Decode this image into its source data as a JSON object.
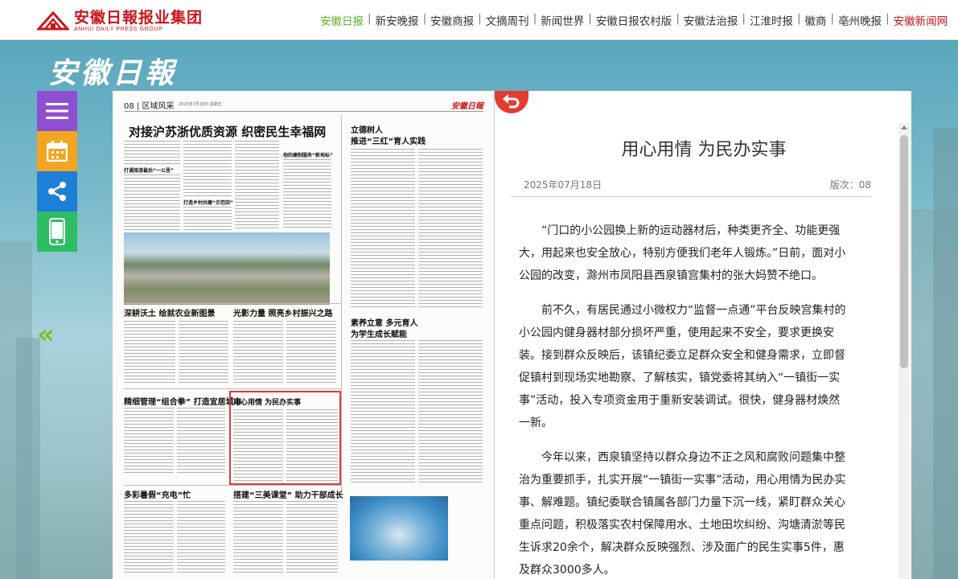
{
  "site": {
    "logo_main": "安徽日報报业集团",
    "logo_sub": "ANHUI DAILY PRESS GROUP"
  },
  "nav": [
    {
      "label": "安徽日报",
      "state": "active"
    },
    {
      "label": "新安晚报",
      "state": "normal"
    },
    {
      "label": "安徽商报",
      "state": "normal"
    },
    {
      "label": "文摘周刊",
      "state": "normal"
    },
    {
      "label": "新闻世界",
      "state": "normal"
    },
    {
      "label": "安徽日报农村版",
      "state": "normal"
    },
    {
      "label": "安徽法治报",
      "state": "normal"
    },
    {
      "label": "江淮时报",
      "state": "normal"
    },
    {
      "label": "徽商",
      "state": "normal"
    },
    {
      "label": "亳州晚报",
      "state": "normal"
    },
    {
      "label": "安徽新闻网",
      "state": "red"
    }
  ],
  "nav_separator": "|",
  "paper_title": "安徽日報",
  "tools": {
    "menu": "menu-icon",
    "calendar": "calendar-icon",
    "share": "share-icon",
    "phone": "phone-icon",
    "prev": "«"
  },
  "newspaper": {
    "page_number": "08 | 区域风采",
    "date_line": "2025年7月18日 星期五",
    "brand": "安徽日報",
    "headlines": {
      "main": "对接沪苏浙优质资源 织密民生幸福网",
      "right_top_a": "立德树人",
      "right_top_b": "推进“三红”育人实践",
      "sub_left_1": "打通旅游最后“一公里”",
      "sub_left_2": "打造乡村共建“示范田”",
      "sub_mid_1": "他的建制服务“新地标”",
      "deep": "深耕沃土 绘就农业新图景",
      "light": "光影力量 照亮乡村振兴之路",
      "teach_a": "素养立意 多元育人",
      "teach_b": "为学生成长赋能",
      "refine": "精细管理“组合拳” 打造宜居城市",
      "heart": "用心用情 为民办实事",
      "summer": "多彩暑假“充电”忙",
      "class": "搭建“三美课堂” 助力干部成长"
    }
  },
  "article": {
    "title": "用心用情 为民办实事",
    "date": "2025年07月18日",
    "edition": "版次：08",
    "paragraphs": [
      "“门口的小公园换上新的运动器材后，种类更齐全、功能更强大，用起来也安全放心，特别方便我们老年人锻炼。”日前，面对小公园的改变，滁州市凤阳县西泉镇宫集村的张大妈赞不绝口。",
      "前不久，有居民通过小微权力“监督一点通”平台反映宫集村的小公园内健身器材部分损坏严重，使用起来不安全，要求更换安装。接到群众反映后，该镇纪委立足群众安全和健身需求，立即督促镇村到现场实地勘察、了解核实，镇党委将其纳入“一镇街一实事”活动，投入专项资金用于重新安装调试。很快，健身器材焕然一新。",
      "今年以来，西泉镇坚持以群众身边不正之风和腐败问题集中整治为重要抓手，扎实开展“一镇街一实事”活动，用心用情为民办实事、解难题。镇纪委联合镇属各部门力量下沉一线，紧盯群众关心重点问题，积极落实农村保障用水、土地田坎纠纷、沟塘清淤等民生诉求20余个，解决群众反映强烈、涉及面广的民生实事5件，惠及群众3000多人。"
    ]
  }
}
